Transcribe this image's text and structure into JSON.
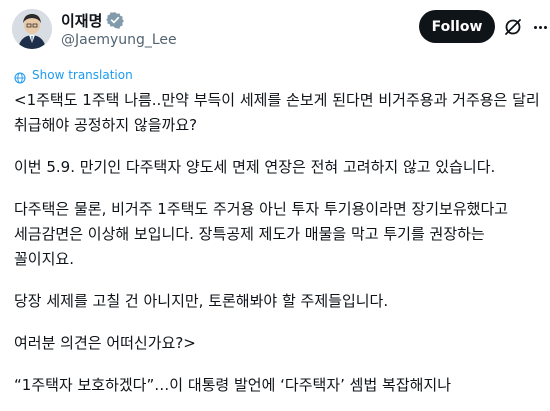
{
  "author": {
    "display_name": "이재명",
    "handle": "@Jaemyung_Lee"
  },
  "icons": {
    "verified": "verified-badge-icon",
    "grok": "grok-icon",
    "more": "more-icon",
    "translate": "globe-icon"
  },
  "colors": {
    "follow_bg": "#0f1419",
    "follow_text": "#ffffff",
    "link": "#1d9bf0",
    "verified_badge": "#829aab",
    "text": "#0f1419",
    "secondary_text": "#536471"
  },
  "actions": {
    "follow_label": "Follow",
    "show_translation": "Show translation"
  },
  "tweet": {
    "paragraphs": [
      "<1주택도 1주택 나름..만약 부득이 세제를 손보게 된다면 비거주용과 거주용은 달리 취급해야 공정하지 않을까요?",
      "이번 5.9. 만기인 다주택자 양도세 면제 연장은 전혀 고려하지 않고 있습니다.",
      "다주택은 물론, 비거주 1주택도 주거용 아닌 투자 투기용이라면 장기보유했다고 세금감면은 이상해 보입니다. 장특공제 제도가 매물을 막고 투기를 권장하는 꼴이지요.",
      "당장 세제를 고칠 건 아니지만, 토론해봐야 할 주제들입니다.",
      "여러분 의견은 어떠신가요?>",
      "“1주택자 보호하겠다”…이 대통령 발언에 ‘다주택자’ 셈법 복잡해지나"
    ]
  }
}
